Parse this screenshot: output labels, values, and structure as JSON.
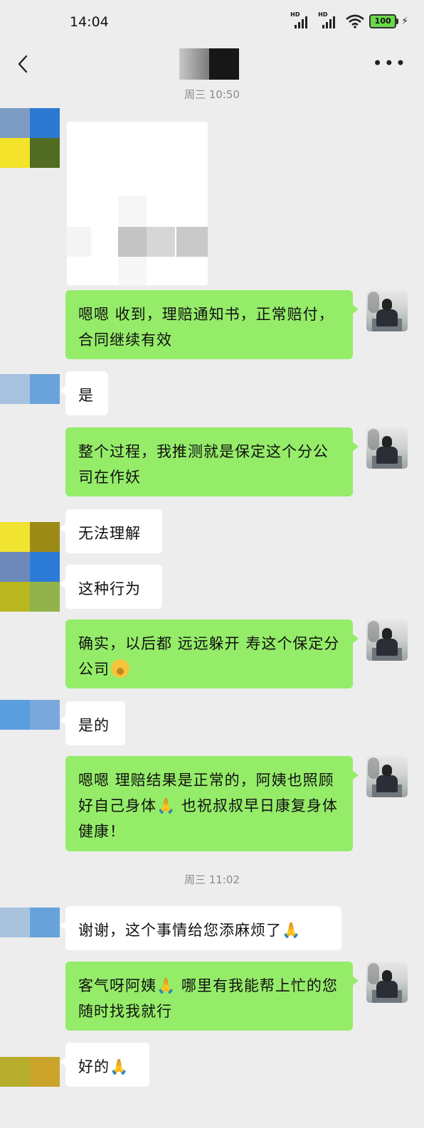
{
  "status_bar": {
    "time": "14:04",
    "battery": "100"
  },
  "nav": {
    "back_icon": "chevron-left-icon",
    "more_icon": "more-horizontal-icon"
  },
  "messages": {
    "ts1": "周三 10:50",
    "m1": "嗯嗯 收到，理赔通知书，正常赔付，合同继续有效",
    "m2": "是",
    "m3": "整个过程，我推测就是保定这个分公司在作妖",
    "m4": "无法理解",
    "m5": "这种行为",
    "m6": "确实，以后都 远远躲开    寿这个保定分公司",
    "m7": "是的",
    "m8": "嗯嗯 理赔结果是正常的，阿姨也照顾好自己身体",
    "m8b": " 也祝叔叔早日康复身体健康！",
    "ts2": "周三 11:02",
    "m9": "谢谢，这个事情给您添麻烦了",
    "m10": "客气呀阿姨",
    "m10b": " 哪里有我能帮上忙的您随时找我就行",
    "m11": "好的"
  },
  "colors": {
    "outgoing": "#95ec69",
    "incoming": "#ffffff",
    "background": "#ededed"
  }
}
